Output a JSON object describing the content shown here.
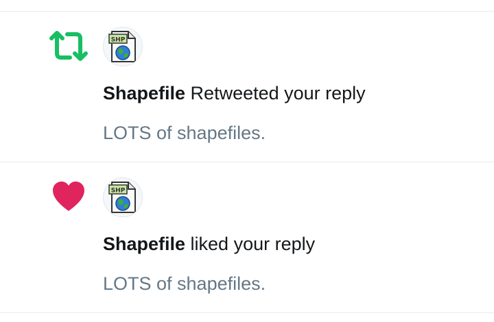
{
  "notifications": [
    {
      "type": "retweet",
      "action_icon": "retweet-icon",
      "avatar_icon": "shp-file-icon",
      "avatar_badge": "SHP",
      "user_name": "Shapefile",
      "action_text": " Retweeted your reply",
      "tweet_text": "LOTS of shapefiles."
    },
    {
      "type": "like",
      "action_icon": "heart-icon",
      "avatar_icon": "shp-file-icon",
      "avatar_badge": "SHP",
      "user_name": "Shapefile",
      "action_text": " liked your reply",
      "tweet_text": "LOTS of shapefiles."
    }
  ],
  "colors": {
    "retweet": "#17bf63",
    "like": "#e0245e",
    "primary_text": "#14171a",
    "secondary_text": "#657786",
    "divider": "#e6ecf0"
  }
}
